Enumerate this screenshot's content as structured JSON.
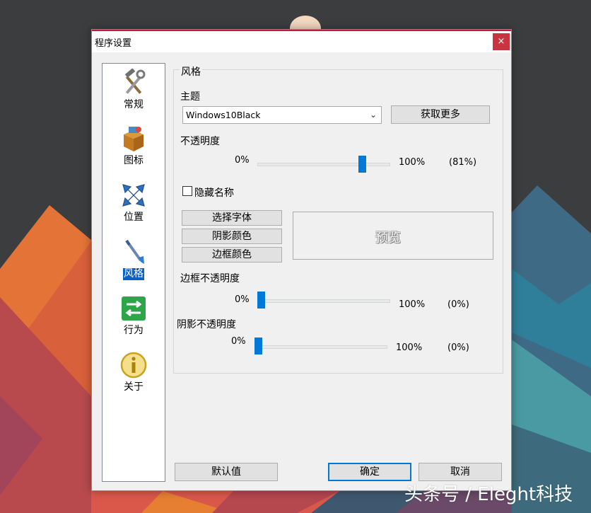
{
  "window": {
    "title": "程序设置",
    "close_glyph": "×"
  },
  "sidebar": {
    "items": [
      {
        "label": "常规",
        "icon": "tools-icon"
      },
      {
        "label": "图标",
        "icon": "box-icon"
      },
      {
        "label": "位置",
        "icon": "move-arrows-icon"
      },
      {
        "label": "风格",
        "icon": "brush-icon",
        "active": true
      },
      {
        "label": "行为",
        "icon": "swap-arrows-icon"
      },
      {
        "label": "关于",
        "icon": "info-icon"
      }
    ]
  },
  "style_group": {
    "legend": "风格",
    "theme": {
      "label": "主题",
      "value": "Windows10Black",
      "get_more": "获取更多"
    },
    "opacity": {
      "label": "不透明度",
      "min": "0%",
      "max": "100%",
      "value_text": "(81%)",
      "value": 0.81
    },
    "hide_name": {
      "label": "隐藏名称",
      "checked": false
    },
    "buttons": {
      "font": "选择字体",
      "shadow_color": "阴影颜色",
      "border_color": "边框颜色"
    },
    "preview": {
      "text": "预览"
    },
    "border_opacity": {
      "label": "边框不透明度",
      "min": "0%",
      "max": "100%",
      "value_text": "(0%)",
      "value": 0
    },
    "shadow_opacity": {
      "label": "阴影不透明度",
      "min": "0%",
      "max": "100%",
      "value_text": "(0%)",
      "value": 0
    }
  },
  "footer": {
    "default": "默认值",
    "ok": "确定",
    "cancel": "取消"
  },
  "watermark": "头条号 / Eleght科技",
  "colors": {
    "accent": "#0078d7",
    "close": "#c9353e",
    "selection": "#0a61c8"
  }
}
